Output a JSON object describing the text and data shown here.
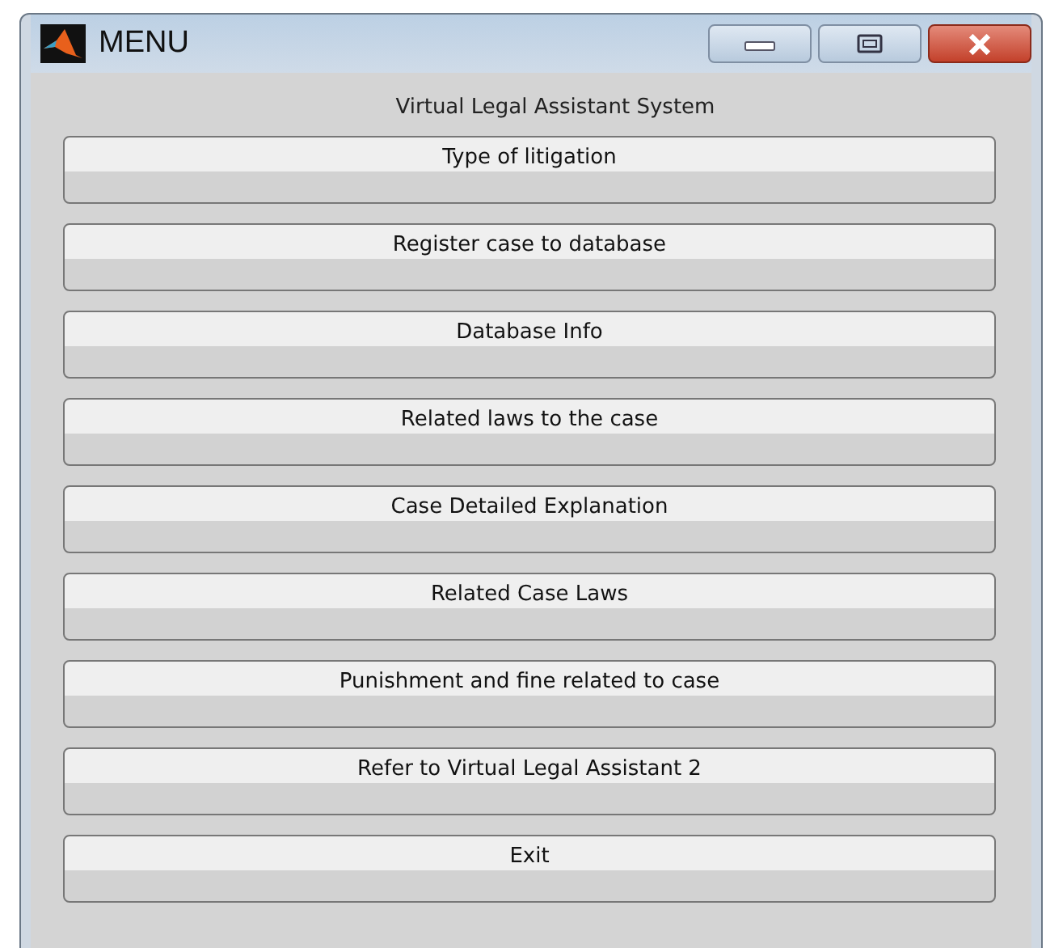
{
  "window": {
    "title": "MENU"
  },
  "heading": "Virtual Legal Assistant System",
  "buttons": [
    {
      "label": "Type of litigation"
    },
    {
      "label": "Register case to database"
    },
    {
      "label": "Database Info"
    },
    {
      "label": "Related laws to the case"
    },
    {
      "label": "Case Detailed Explanation"
    },
    {
      "label": "Related Case Laws"
    },
    {
      "label": "Punishment and fine related to case"
    },
    {
      "label": "Refer to Virtual Legal Assistant 2"
    },
    {
      "label": "Exit"
    }
  ]
}
